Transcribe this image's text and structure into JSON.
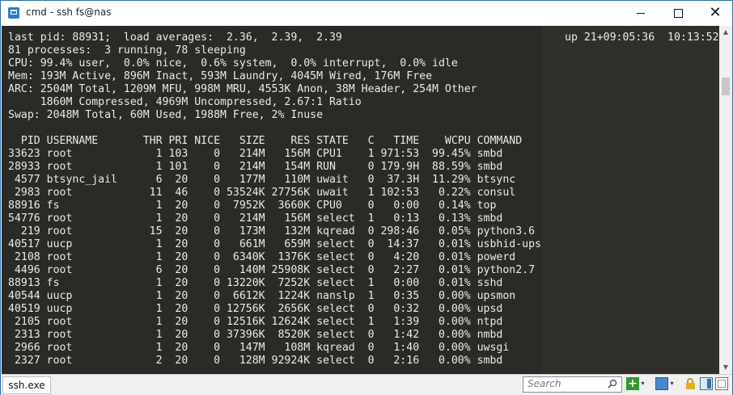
{
  "window": {
    "title": "cmd - ssh  fs@nas",
    "minimize_label": "–",
    "maximize_label": "☐",
    "close_label": "✕"
  },
  "terminal": {
    "uptime": "up 21+09:05:36  10:13:52",
    "lines": [
      "last pid: 88931;  load averages:  2.36,  2.39,  2.39",
      "81 processes:  3 running, 78 sleeping",
      "CPU: 99.4% user,  0.0% nice,  0.6% system,  0.0% interrupt,  0.0% idle",
      "Mem: 193M Active, 896M Inact, 593M Laundry, 4045M Wired, 176M Free",
      "ARC: 2504M Total, 1209M MFU, 998M MRU, 4553K Anon, 38M Header, 254M Other",
      "     1860M Compressed, 4969M Uncompressed, 2.67:1 Ratio",
      "Swap: 2048M Total, 60M Used, 1988M Free, 2% Inuse",
      "",
      "  PID USERNAME       THR PRI NICE   SIZE    RES STATE   C   TIME    WCPU COMMAND",
      "33623 root             1 103    0   214M   156M CPU1    1 971:53  99.45% smbd",
      "28933 root             1 101    0   214M   154M RUN     0 179.9H  88.59% smbd",
      " 4577 btsync_jail      6  20    0   177M   110M uwait   0  37.3H  11.29% btsync",
      " 2983 root            11  46    0 53524K 27756K uwait   1 102:53   0.22% consul",
      "88916 fs               1  20    0  7952K  3660K CPU0    0   0:00   0.14% top",
      "54776 root             1  20    0   214M   156M select  1   0:13   0.13% smbd",
      "  219 root            15  20    0   173M   132M kqread  0 298:46   0.05% python3.6",
      "40517 uucp             1  20    0   661M   659M select  0  14:37   0.01% usbhid-ups",
      " 2108 root             1  20    0  6340K  1376K select  0   4:20   0.01% powerd",
      " 4496 root             6  20    0   140M 25908K select  0   2:27   0.01% python2.7",
      "88913 fs               1  20    0 13220K  7252K select  1   0:00   0.01% sshd",
      "40544 uucp             1  20    0  6612K  1224K nanslp  1   0:35   0.00% upsmon",
      "40519 uucp             1  20    0 12756K  2656K select  0   0:32   0.00% upsd",
      " 2105 root             1  20    0 12516K 12624K select  1   1:39   0.00% ntpd",
      " 2313 root             1  20    0 37396K  8520K select  0   1:42   0.00% nmbd",
      " 2966 root             1  20    0   147M   108M kqread  0   1:40   0.00% uwsgi",
      " 2327 root             2  20    0   128M 92924K select  0   2:16   0.00% smbd"
    ]
  },
  "statusbar": {
    "tab_label": "ssh.exe",
    "search_placeholder": "Search",
    "add_label": "+",
    "dropdown_arrow": "▾"
  },
  "scrollbar": {
    "up_arrow": "▲",
    "down_arrow": "▼"
  },
  "icons": {
    "app": "console-icon",
    "search": "search-icon",
    "add": "plus-icon",
    "lock": "lock-icon"
  },
  "colors": {
    "terminal_bg": "#2a2b26",
    "terminal_fg": "#e9e9e9",
    "title_bar": "#ffffff",
    "status_bar": "#f0f0f0",
    "add_green": "#2e9a2e",
    "lock_gold": "#e0b020",
    "accent_blue": "#2d7bd0"
  }
}
